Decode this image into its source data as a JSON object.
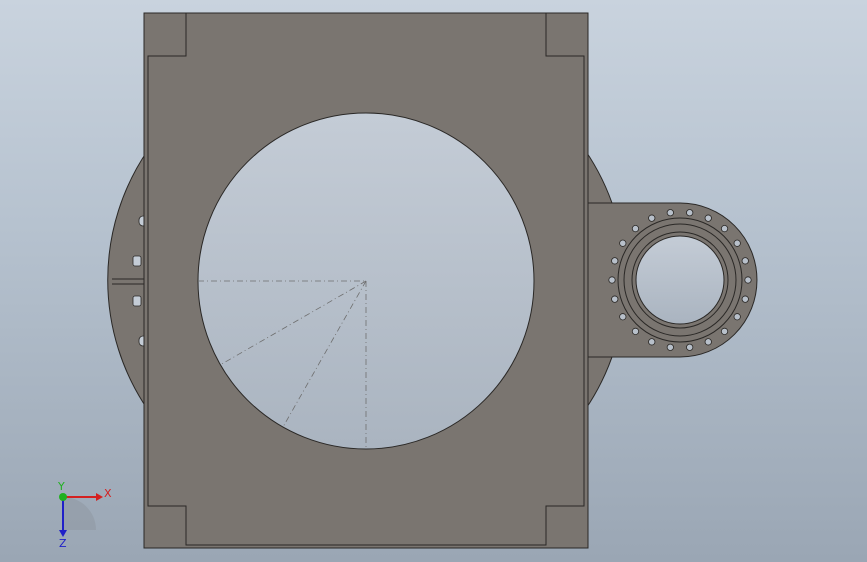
{
  "viewport": {
    "background_top": "#c9d3de",
    "background_bottom": "#9aa6b4"
  },
  "model": {
    "body_fill": "#7a7570",
    "edge_color": "#2a2826",
    "hole_fill_top": "#c4ccd6",
    "hole_fill_bottom": "#aab4c0",
    "centerline_color": "#6e6e6e",
    "bolt_hole_count": 22
  },
  "triad": {
    "x_label": "X",
    "y_label": "Y",
    "z_label": "Z",
    "x_color": "#d42020",
    "y_color": "#20b020",
    "z_color": "#2020c8"
  }
}
